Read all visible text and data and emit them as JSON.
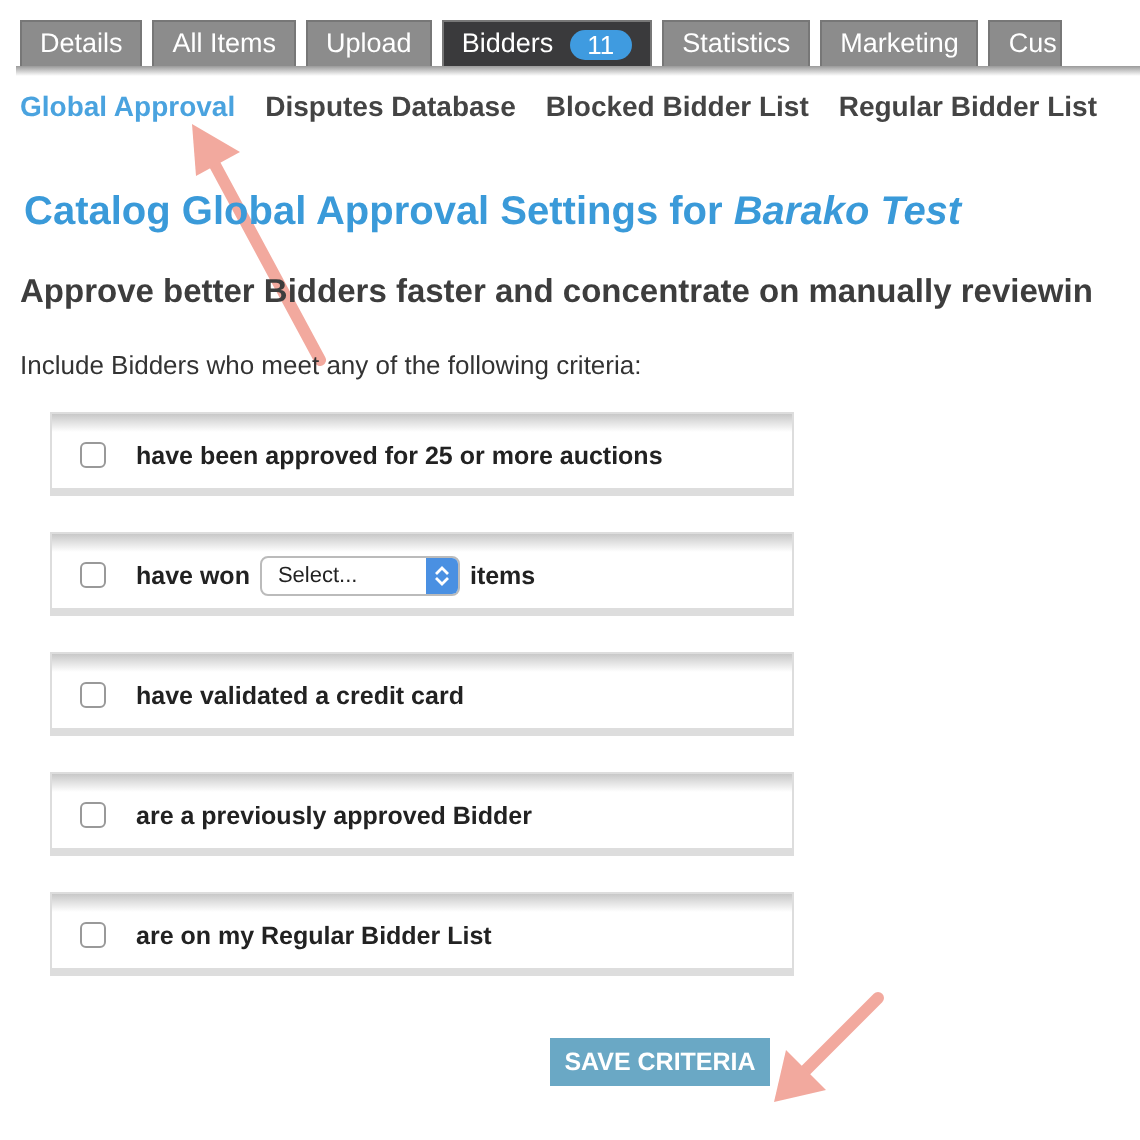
{
  "tabs": [
    {
      "label": "Details",
      "selected": false
    },
    {
      "label": "All Items",
      "selected": false
    },
    {
      "label": "Upload",
      "selected": false
    },
    {
      "label": "Bidders",
      "selected": true,
      "badge": "11"
    },
    {
      "label": "Statistics",
      "selected": false
    },
    {
      "label": "Marketing",
      "selected": false
    },
    {
      "label": "Cus",
      "selected": false
    }
  ],
  "subnav": [
    {
      "label": "Global Approval",
      "selected": true
    },
    {
      "label": "Disputes Database",
      "selected": false
    },
    {
      "label": "Blocked Bidder List",
      "selected": false
    },
    {
      "label": "Regular Bidder List",
      "selected": false
    }
  ],
  "title": "Catalog Global Approval Settings for *Barako Test*",
  "subtitle": "Approve better Bidders faster and concentrate on manually reviewin",
  "intro": "Include Bidders who meet any of the following criteria:",
  "criteria": [
    {
      "kind": "text",
      "text": "have been approved for 25 or more auctions",
      "checked": false
    },
    {
      "kind": "select",
      "text": "have won",
      "select": "Select...",
      "suffix": "items",
      "checked": false
    },
    {
      "kind": "text",
      "text": "have validated a credit card",
      "checked": false
    },
    {
      "kind": "text",
      "text": "are a previously approved Bidder",
      "checked": false
    },
    {
      "kind": "text",
      "text": "are on my Regular Bidder List",
      "checked": false
    }
  ],
  "save_button": "SAVE CRITERIA"
}
